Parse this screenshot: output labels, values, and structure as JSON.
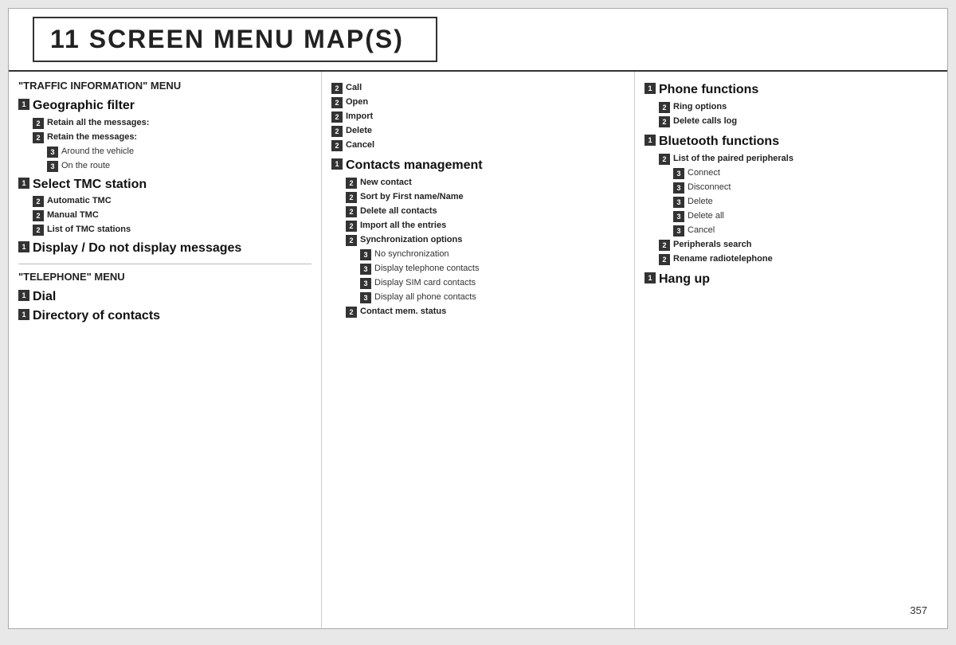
{
  "title": "11   SCREEN MENU MAP(S)",
  "page_number": "357",
  "column1": {
    "menu_title": "\"TRAFFIC INFORMATION\" MENU",
    "sections": [
      {
        "id": "geo-filter",
        "badge": "1",
        "label": "Geographic filter",
        "level": "level1",
        "children": [
          {
            "badge": "2",
            "label": "Retain all the messages:",
            "level": "level2"
          },
          {
            "badge": "2",
            "label": "Retain the messages:",
            "level": "level2"
          },
          {
            "badge": "3",
            "label": "Around the vehicle",
            "level": "level3"
          },
          {
            "badge": "3",
            "label": "On the route",
            "level": "level3"
          }
        ]
      },
      {
        "id": "select-tmc",
        "badge": "1",
        "label": "Select TMC station",
        "level": "level1",
        "children": [
          {
            "badge": "2",
            "label": "Automatic TMC",
            "level": "level2"
          },
          {
            "badge": "2",
            "label": "Manual TMC",
            "level": "level2"
          },
          {
            "badge": "2",
            "label": "List of TMC stations",
            "level": "level2"
          }
        ]
      },
      {
        "id": "display-messages",
        "badge": "1",
        "label": "Display / Do not display messages",
        "level": "level1",
        "children": []
      }
    ],
    "telephone_menu_title": "\"TELEPHONE\" MENU",
    "telephone_sections": [
      {
        "badge": "1",
        "label": "Dial",
        "level": "level1",
        "children": []
      },
      {
        "badge": "1",
        "label": "Directory of contacts",
        "level": "level1",
        "children": []
      }
    ]
  },
  "column2": {
    "top_items": [
      {
        "badge": "2",
        "label": "Call",
        "level": "level2"
      },
      {
        "badge": "2",
        "label": "Open",
        "level": "level2"
      },
      {
        "badge": "2",
        "label": "Import",
        "level": "level2"
      },
      {
        "badge": "2",
        "label": "Delete",
        "level": "level2"
      },
      {
        "badge": "2",
        "label": "Cancel",
        "level": "level2"
      }
    ],
    "contacts_section": {
      "badge": "1",
      "label": "Contacts management",
      "level": "level1",
      "children": [
        {
          "badge": "2",
          "label": "New contact",
          "level": "level2"
        },
        {
          "badge": "2",
          "label": "Sort by First name/Name",
          "level": "level2"
        },
        {
          "badge": "2",
          "label": "Delete all contacts",
          "level": "level2"
        },
        {
          "badge": "2",
          "label": "Import all the entries",
          "level": "level2"
        },
        {
          "badge": "2",
          "label": "Synchronization options",
          "level": "level2"
        },
        {
          "badge": "3",
          "label": "No synchronization",
          "level": "level3"
        },
        {
          "badge": "3",
          "label": "Display telephone contacts",
          "level": "level3"
        },
        {
          "badge": "3",
          "label": "Display SIM card contacts",
          "level": "level3"
        },
        {
          "badge": "3",
          "label": "Display all phone contacts",
          "level": "level3"
        },
        {
          "badge": "2",
          "label": "Contact mem. status",
          "level": "level2"
        }
      ]
    }
  },
  "column3": {
    "phone_section": {
      "badge": "1",
      "label": "Phone functions",
      "level": "level1",
      "children": [
        {
          "badge": "2",
          "label": "Ring options",
          "level": "level2"
        },
        {
          "badge": "2",
          "label": "Delete calls log",
          "level": "level2"
        }
      ]
    },
    "bluetooth_section": {
      "badge": "1",
      "label": "Bluetooth functions",
      "level": "level1",
      "children": [
        {
          "badge": "2",
          "label": "List of the paired peripherals",
          "level": "level2"
        },
        {
          "badge": "3",
          "label": "Connect",
          "level": "level3"
        },
        {
          "badge": "3",
          "label": "Disconnect",
          "level": "level3"
        },
        {
          "badge": "3",
          "label": "Delete",
          "level": "level3"
        },
        {
          "badge": "3",
          "label": "Delete all",
          "level": "level3"
        },
        {
          "badge": "3",
          "label": "Cancel",
          "level": "level3"
        },
        {
          "badge": "2",
          "label": "Peripherals search",
          "level": "level2"
        },
        {
          "badge": "2",
          "label": "Rename radiotelephone",
          "level": "level2"
        }
      ]
    },
    "hangup_section": {
      "badge": "1",
      "label": "Hang up",
      "level": "level1"
    }
  }
}
